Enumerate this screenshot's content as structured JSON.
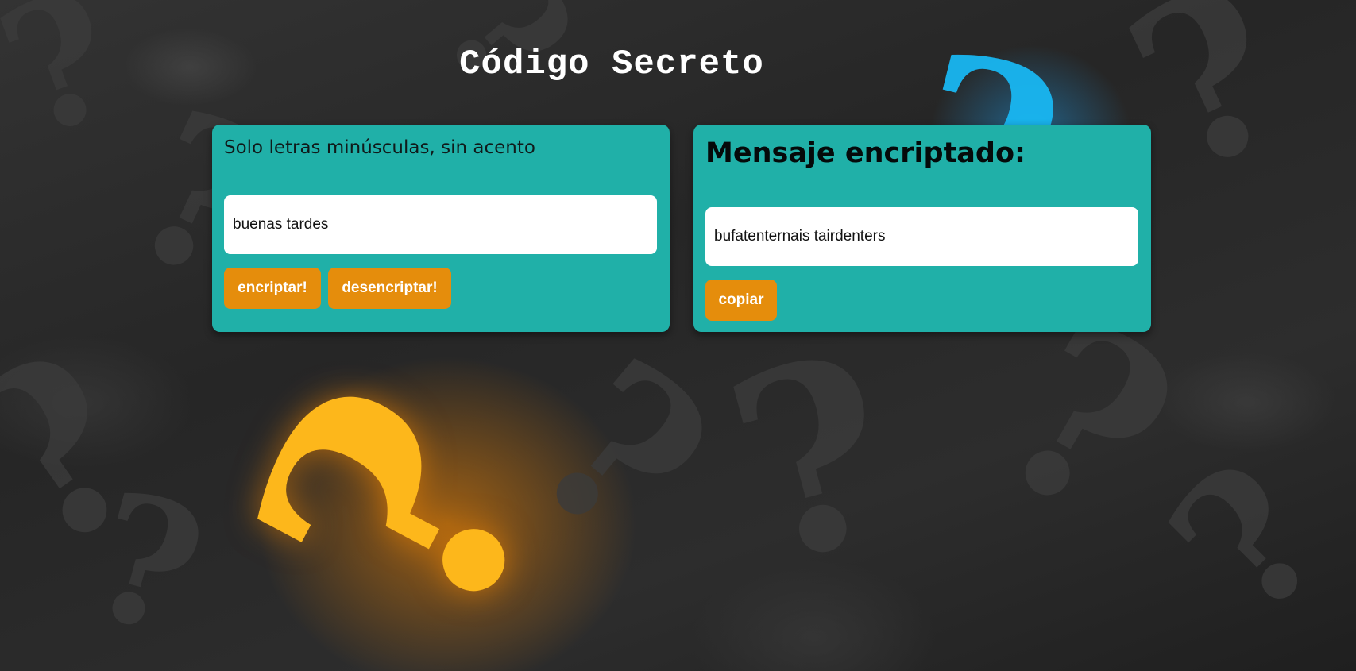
{
  "page": {
    "title": "Código Secreto"
  },
  "input_card": {
    "hint": "Solo letras minúsculas, sin acento",
    "input_value": "buenas tardes",
    "encrypt_label": "encriptar!",
    "decrypt_label": "desencriptar!"
  },
  "output_card": {
    "title": "Mensaje encriptado:",
    "output_value": "bufatenternais tairdenters",
    "copy_label": "copiar"
  },
  "colors": {
    "card_bg": "#20b0a8",
    "button_bg": "#e58d0c",
    "accent_orange": "#fdb71b",
    "accent_blue": "#19b7f2"
  },
  "icons": {
    "background_orange": "question-mark-icon",
    "background_blue": "question-mark-icon"
  }
}
